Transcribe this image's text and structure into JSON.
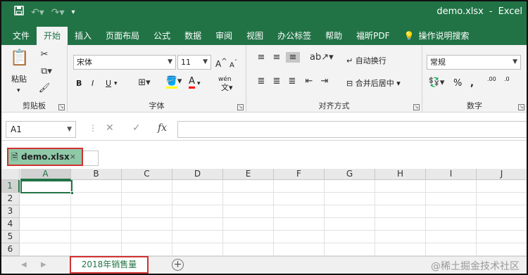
{
  "titlebar": {
    "save_icon": "save-icon",
    "undo_icon": "undo-icon",
    "redo_icon": "redo-icon",
    "customize_icon": "customize-qat-icon",
    "filename": "demo.xlsx",
    "separator": "-",
    "app": "Excel"
  },
  "tabs": [
    "文件",
    "开始",
    "插入",
    "页面布局",
    "公式",
    "数据",
    "审阅",
    "视图",
    "办公标签",
    "帮助",
    "福昕PDF",
    "操作说明搜索"
  ],
  "active_tab": "开始",
  "ribbon": {
    "clipboard": {
      "paste": "粘贴",
      "label": "剪贴板"
    },
    "font": {
      "name": "宋体",
      "size": "11",
      "bold": "B",
      "italic": "I",
      "underline": "U",
      "font_color_letter": "A",
      "phonetic": "wén",
      "label": "字体"
    },
    "alignment": {
      "wrap": "自动换行",
      "merge": "合并后居中",
      "label": "对齐方式"
    },
    "number": {
      "format": "常规",
      "percent": "%",
      "comma": ",",
      "inc_decimal": ".00",
      "dec_decimal": ".0",
      "label": "数字"
    }
  },
  "formula_bar": {
    "name_box": "A1",
    "cancel": "✕",
    "enter": "✓",
    "fx": "fx",
    "value": ""
  },
  "workbook_tab": {
    "name": "demo.xlsx",
    "close": "×"
  },
  "grid": {
    "columns": [
      "A",
      "B",
      "C",
      "D",
      "E",
      "F",
      "G",
      "H",
      "I",
      "J"
    ],
    "rows": [
      "1",
      "2",
      "3",
      "4",
      "5",
      "6"
    ],
    "selected_cell": "A1"
  },
  "sheet_tabs": {
    "active": "2018年销售量",
    "add": "⊕"
  },
  "watermark": "@稀土掘金技术社区",
  "colors": {
    "accent": "#217346",
    "highlight_border": "#d23030",
    "workbook_tab_bg": "#8fc9a8"
  }
}
